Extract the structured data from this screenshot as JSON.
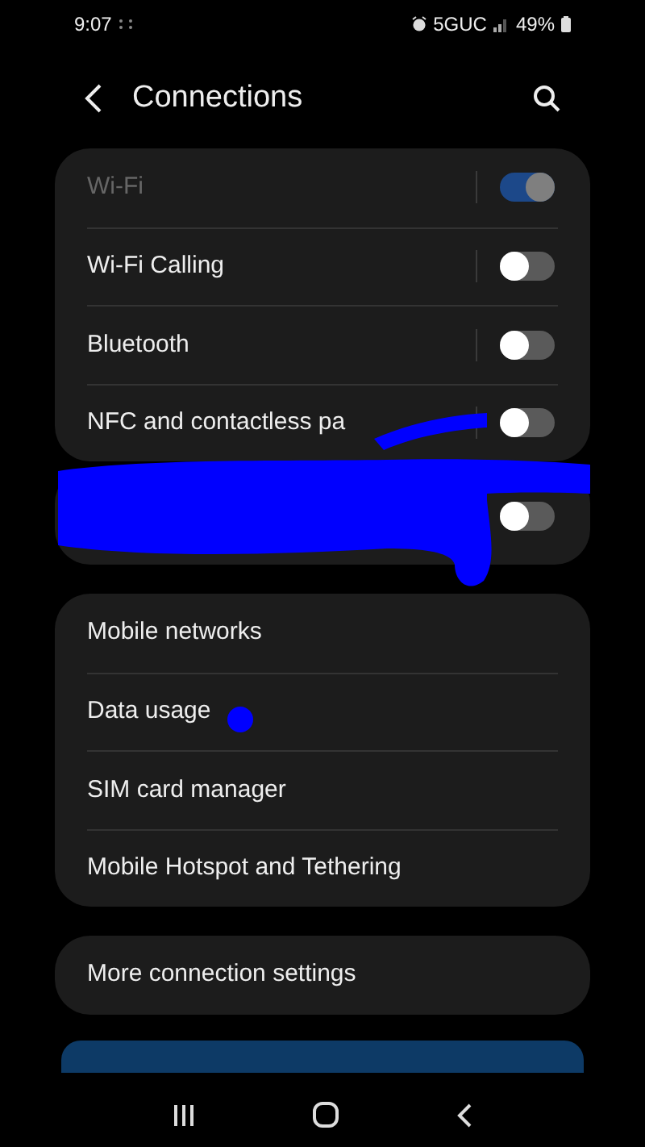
{
  "status_bar": {
    "time": "9:07",
    "network": "5GUC",
    "battery": "49%"
  },
  "header": {
    "title": "Connections"
  },
  "groups": [
    {
      "items": [
        {
          "label": "Wi-Fi",
          "on": true,
          "disabled": true
        },
        {
          "label": "Wi-Fi Calling",
          "on": false,
          "disabled": false
        },
        {
          "label": "Bluetooth",
          "on": false,
          "disabled": false
        },
        {
          "label": "NFC and contactless pa",
          "on": false,
          "disabled": false
        }
      ]
    },
    {
      "items": [
        {
          "on": false,
          "disabled": false
        }
      ]
    },
    {
      "items": [
        {
          "label": "Mobile networks"
        },
        {
          "label": "Data usage"
        },
        {
          "label": "SIM card manager"
        },
        {
          "label": "Mobile Hotspot and Tethering"
        }
      ]
    },
    {
      "items": [
        {
          "label": "More connection settings"
        }
      ]
    }
  ]
}
